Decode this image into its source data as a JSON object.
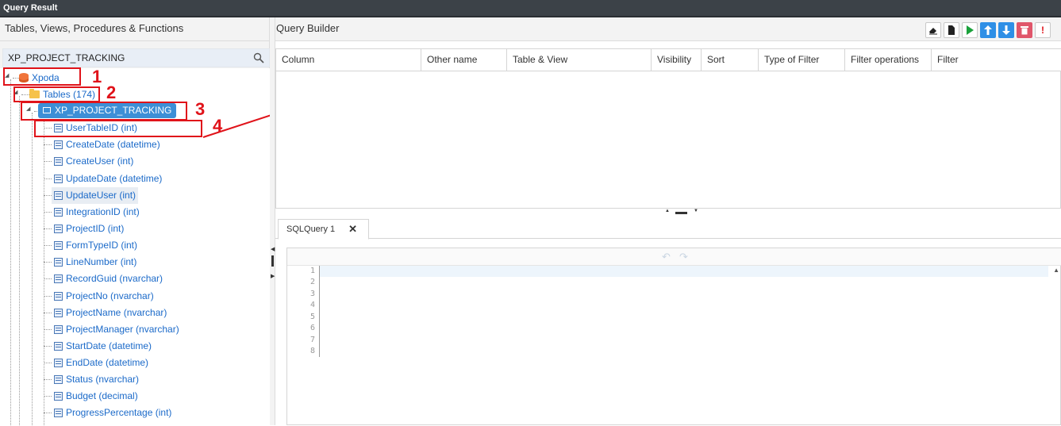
{
  "window": {
    "title": "Query Result"
  },
  "left_panel": {
    "header": "Tables, Views, Procedures & Functions",
    "search": {
      "value": "XP_PROJECT_TRACKING"
    },
    "tree": {
      "database": "Xpoda",
      "tables_folder": "Tables (174)",
      "table": "XP_PROJECT_TRACKING",
      "columns": [
        "UserTableID (int)",
        "CreateDate (datetime)",
        "CreateUser (int)",
        "UpdateDate (datetime)",
        "UpdateUser (int)",
        "IntegrationID (int)",
        "ProjectID (int)",
        "FormTypeID (int)",
        "LineNumber (int)",
        "RecordGuid (nvarchar)",
        "ProjectNo (nvarchar)",
        "ProjectName (nvarchar)",
        "ProjectManager (nvarchar)",
        "StartDate (datetime)",
        "EndDate (datetime)",
        "Status (nvarchar)",
        "Budget (decimal)",
        "ProgressPercentage (int)"
      ]
    }
  },
  "annotations": [
    "1",
    "2",
    "3",
    "4"
  ],
  "query_builder": {
    "title": "Query Builder",
    "toolbar_icons": [
      "eraser-icon",
      "new-document-icon",
      "run-icon",
      "move-up-icon",
      "move-down-icon",
      "delete-icon",
      "warning-icon"
    ],
    "columns": [
      "Column",
      "Other name",
      "Table & View",
      "Visibility",
      "Sort",
      "Type of Filter",
      "Filter operations",
      "Filter"
    ]
  },
  "sql_editor": {
    "tab_label": "SQLQuery 1",
    "close_glyph": "✕",
    "line_numbers": [
      "1",
      "2",
      "3",
      "4",
      "5",
      "6",
      "7",
      "8"
    ]
  },
  "colors": {
    "titlebar": "#3c4248",
    "tree_text": "#1b6ac9",
    "selected_table": "#3d8fd6",
    "annotation": "#e0131a"
  }
}
